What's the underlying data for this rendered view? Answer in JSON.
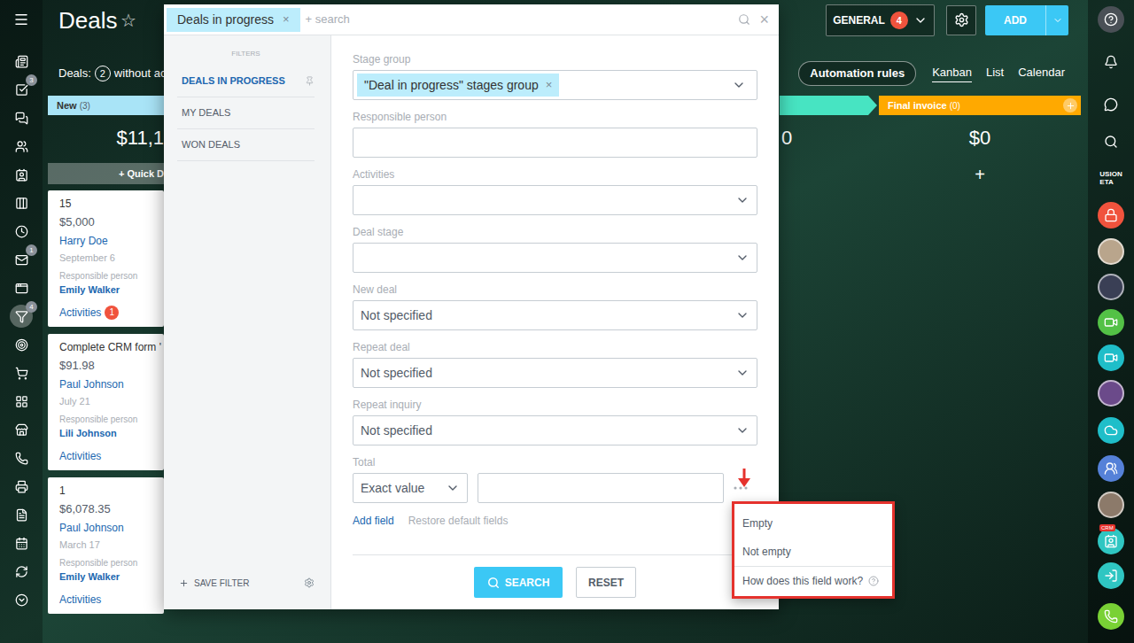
{
  "page": {
    "title": "Deals",
    "star": "☆"
  },
  "search": {
    "tag": "Deals in progress",
    "tag_remove": "×",
    "placeholder": "+ search",
    "clear": "×"
  },
  "header_buttons": {
    "general": {
      "label": "GENERAL",
      "badge": "4"
    },
    "add": {
      "label": "ADD"
    }
  },
  "toolbar": {
    "deals_label": "Deals:",
    "deals_count": "2",
    "deals_suffix": "without act",
    "automation": "Automation rules",
    "views": [
      {
        "label": "Kanban",
        "selected": true
      },
      {
        "label": "List",
        "selected": false
      },
      {
        "label": "Calendar",
        "selected": false
      }
    ]
  },
  "left_rail": [
    {
      "badge": null,
      "selected": false
    },
    {
      "badge": null,
      "selected": false
    },
    {
      "badge": "3",
      "selected": false
    },
    {
      "badge": null,
      "selected": false
    },
    {
      "badge": null,
      "selected": false
    },
    {
      "badge": null,
      "selected": false
    },
    {
      "badge": null,
      "selected": false
    },
    {
      "badge": null,
      "selected": false
    },
    {
      "badge": "1",
      "selected": false
    },
    {
      "badge": null,
      "selected": false
    },
    {
      "badge": "4",
      "selected": true
    },
    {
      "badge": null,
      "selected": false
    },
    {
      "badge": null,
      "selected": false
    },
    {
      "badge": null,
      "selected": false
    },
    {
      "badge": null,
      "selected": false
    },
    {
      "badge": null,
      "selected": false
    },
    {
      "badge": null,
      "selected": false
    },
    {
      "badge": null,
      "selected": false
    },
    {
      "badge": null,
      "selected": false
    },
    {
      "badge": null,
      "selected": false
    },
    {
      "badge": null,
      "selected": false
    }
  ],
  "right_rail": [
    {
      "kind": "icon"
    },
    {
      "kind": "icon"
    },
    {
      "kind": "icon"
    },
    {
      "kind": "icon"
    },
    {
      "kind": "logo",
      "lines": [
        "USION",
        "ETA"
      ]
    },
    {
      "kind": "icon"
    },
    {
      "kind": "avatar",
      "color": "#b9a58c"
    },
    {
      "kind": "avatar",
      "color": "#3a3f55"
    },
    {
      "kind": "icon"
    },
    {
      "kind": "icon"
    },
    {
      "kind": "avatar",
      "color": "#6b4a8a"
    },
    {
      "kind": "icon"
    },
    {
      "kind": "icon"
    },
    {
      "kind": "avatar",
      "color": "#8c7a6a"
    },
    {
      "kind": "icon",
      "badge": "CRM"
    },
    {
      "kind": "icon"
    },
    {
      "kind": "icon"
    }
  ],
  "columns": {
    "new": {
      "name": "New",
      "count": "(3)",
      "total": "$11,1",
      "quick": "+ Quick D",
      "color": "#a9e4f7",
      "cards": [
        {
          "title": "15",
          "amount": "$5,000",
          "contact": "Harry Doe",
          "date": "September 6",
          "responsible_label": "Responsible person",
          "responsible": "Emily Walker",
          "activities": "Activities",
          "activities_badge": "1"
        },
        {
          "title": "Complete CRM form '",
          "amount": "$91.98",
          "contact": "Paul Johnson",
          "date": "July 21",
          "responsible_label": "Responsible person",
          "responsible": "Lili Johnson",
          "activities": "Activities",
          "activities_badge": null
        },
        {
          "title": "1",
          "amount": "$6,078.35",
          "contact": "Paul Johnson",
          "date": "March 17",
          "responsible_label": "Responsible person",
          "responsible": "Emily Walker",
          "activities": "Activities",
          "activities_badge": null
        }
      ]
    },
    "partial": {
      "total": "0",
      "color": "#47e4c2"
    },
    "final": {
      "name": "Final invoice",
      "count": "(0)",
      "total": "$0",
      "add": "+",
      "color": "#ffa900"
    }
  },
  "filter": {
    "header": "FILTERS",
    "presets": [
      {
        "label": "DEALS IN PROGRESS",
        "selected": true,
        "pinned": true
      },
      {
        "label": "MY DEALS",
        "selected": false,
        "pinned": false
      },
      {
        "label": "WON DEALS",
        "selected": false,
        "pinned": false
      }
    ],
    "save": "SAVE FILTER",
    "fields": [
      {
        "label": "Stage group",
        "kind": "tags",
        "tags": [
          {
            "label": "\"Deal in progress\" stages group",
            "remove": "×"
          }
        ]
      },
      {
        "label": "Responsible person",
        "kind": "input",
        "value": ""
      },
      {
        "label": "Activities",
        "kind": "select",
        "value": ""
      },
      {
        "label": "Deal stage",
        "kind": "select",
        "value": ""
      },
      {
        "label": "New deal",
        "kind": "select",
        "value": "Not specified"
      },
      {
        "label": "Repeat deal",
        "kind": "select",
        "value": "Not specified"
      },
      {
        "label": "Repeat inquiry",
        "kind": "select",
        "value": "Not specified"
      },
      {
        "label": "Total",
        "kind": "number",
        "mode": "Exact value",
        "value": "",
        "menu_open": true
      }
    ],
    "add_field": "Add field",
    "restore": "Restore default fields",
    "search_button": "SEARCH",
    "reset_button": "RESET"
  },
  "menu": {
    "items": [
      {
        "label": "Empty",
        "kind": "option"
      },
      {
        "label": "Not empty",
        "kind": "option"
      },
      {
        "label": "How does this field work?",
        "kind": "help"
      }
    ]
  }
}
